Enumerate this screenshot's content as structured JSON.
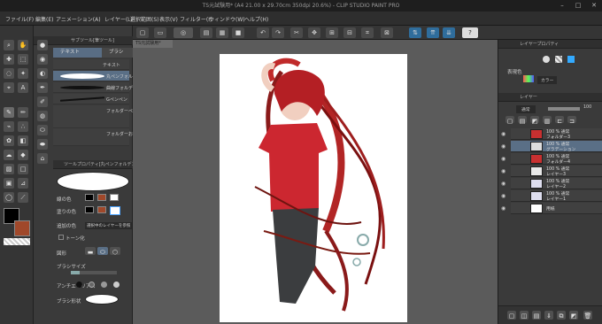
{
  "window": {
    "title": "TS元試験用* (A4 21.00 x 29.70cm 350dpi 20.6%) - CLIP STUDIO PAINT PRO",
    "controls": [
      "–",
      "□",
      "✕"
    ]
  },
  "menu": [
    "ファイル(F)",
    "編集(E)",
    "アニメーション(A)",
    "レイヤー(L)",
    "選択範囲(S)",
    "表示(V)",
    "フィルター(I)",
    "ウィンドウ(W)",
    "ヘルプ(H)"
  ],
  "command_icons": [
    "new-file-icon",
    "open-icon",
    "save-icon",
    "undo-icon",
    "redo-icon",
    "clear-icon",
    "transform-icon",
    "deselect-icon",
    "invert-icon",
    "grid-icon",
    "ruler-icon",
    "cloud-icon",
    "upload-icon",
    "help-icon"
  ],
  "sub_tool": {
    "header": "サブツール[筆ツール]",
    "tabs": [
      "テキスト",
      "ブラシ"
    ],
    "brushes": [
      "テキスト",
      "丸ペンフォルデン",
      "曲線フォルデン",
      "Gペンペン",
      "フォルダーペン",
      "フォルダーおしゅう"
    ]
  },
  "tool_property": {
    "header": "ツールプロパティ[丸ペンフォルデン]",
    "rows": [
      "線の色",
      "塗りの色",
      "追加の色",
      "トーン化",
      "図形",
      "ブラシサイズ",
      "アンチエイリアス",
      "ブラシ形状"
    ],
    "layer_mode": "選択中のレイヤーを参照"
  },
  "canvas": {
    "tab": "TS元試験用*"
  },
  "layer_property": {
    "header": "レイヤープロパティ",
    "label": "表現色",
    "value": "カラー"
  },
  "layer_panel": {
    "header": "レイヤー",
    "blend": "通常",
    "opacity": "100",
    "layers": [
      {
        "l1": "100 % 通常",
        "l2": "フォルダー3",
        "selected": false
      },
      {
        "l1": "100 % 通常",
        "l2": "グラデーション",
        "selected": true
      },
      {
        "l1": "100 % 通常",
        "l2": "フォルダー4",
        "selected": false
      },
      {
        "l1": "100 % 通常",
        "l2": "レイヤー3",
        "selected": false
      },
      {
        "l1": "100 % 通常",
        "l2": "レイヤー2",
        "selected": false
      },
      {
        "l1": "100 % 通常",
        "l2": "レイヤー1",
        "selected": false
      },
      {
        "l1": "",
        "l2": "用紙",
        "selected": false
      }
    ]
  },
  "colors": {
    "main": "#000000",
    "sub": "#a0482a",
    "accent": "#5a6f86"
  }
}
